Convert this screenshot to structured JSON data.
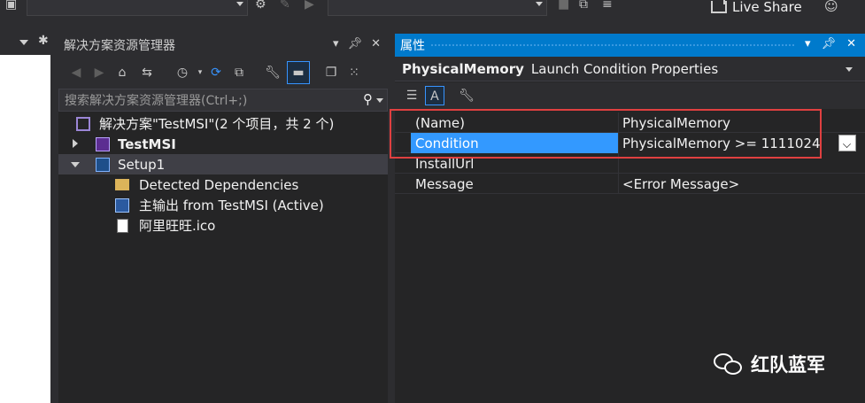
{
  "toolbar": {
    "live_share_label": "Live Share"
  },
  "solution_explorer": {
    "title": "解决方案资源管理器",
    "search_placeholder": "搜索解决方案资源管理器(Ctrl+;)",
    "tree": [
      {
        "label": "解决方案\"TestMSI\"(2 个项目，共 2 个)",
        "icon": "solution-icon",
        "level": 0
      },
      {
        "label": "TestMSI",
        "icon": "csharp-project-icon",
        "level": 0,
        "expander": "collapsed",
        "bold": true
      },
      {
        "label": "Setup1",
        "icon": "setup-project-icon",
        "level": 0,
        "expander": "expanded",
        "selected": true
      },
      {
        "label": "Detected Dependencies",
        "icon": "folder-icon",
        "level": 1
      },
      {
        "label": "主输出 from TestMSI (Active)",
        "icon": "primary-output-icon",
        "level": 1
      },
      {
        "label": "阿里旺旺.ico",
        "icon": "file-icon",
        "level": 1
      }
    ]
  },
  "properties": {
    "title": "属性",
    "object_name": "PhysicalMemory",
    "object_type": "Launch Condition Properties",
    "rows": [
      {
        "name": "(Name)",
        "value": "PhysicalMemory"
      },
      {
        "name": "Condition",
        "value": "PhysicalMemory >= 1111024",
        "selected": true
      },
      {
        "name": "InstallUrl",
        "value": ""
      },
      {
        "name": "Message",
        "value": "<Error Message>"
      }
    ]
  },
  "watermark": {
    "text": "红队蓝军"
  },
  "colors": {
    "accent": "#007acc",
    "selection": "#3399ff",
    "highlight_box": "#e04040"
  }
}
